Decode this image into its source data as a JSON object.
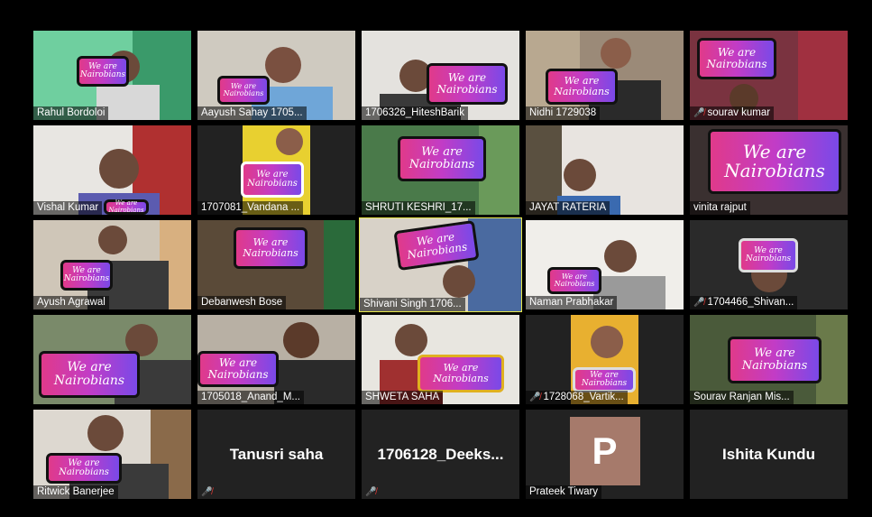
{
  "colors": {
    "background": "#000000",
    "active_speaker_border": "#e8e84a",
    "muted_icon": "#e53935",
    "avatar_bg": "#a67a6b"
  },
  "sign_text": "We are Nairobians",
  "participants": [
    {
      "name": "Rahul Bordoloi",
      "muted": false
    },
    {
      "name": "Aayush Sahay 1705...",
      "muted": false
    },
    {
      "name": "1706326_HiteshBarik",
      "muted": false
    },
    {
      "name": "Nidhi 1729038",
      "muted": false
    },
    {
      "name": "sourav kumar",
      "muted": true
    },
    {
      "name": "Vishal Kumar",
      "muted": false
    },
    {
      "name": "1707081_Vandana ...",
      "muted": false
    },
    {
      "name": "SHRUTI KESHRI_17...",
      "muted": false
    },
    {
      "name": "JAYAT RATERIA",
      "muted": false
    },
    {
      "name": "vinita rajput",
      "muted": false
    },
    {
      "name": "Ayush Agrawal",
      "muted": false
    },
    {
      "name": "Debanwesh Bose",
      "muted": false
    },
    {
      "name": "Shivani Singh 1706...",
      "muted": false,
      "active": true
    },
    {
      "name": "Naman Prabhakar",
      "muted": false
    },
    {
      "name": "1704466_Shivan...",
      "muted": true
    },
    {
      "name": "",
      "muted": false
    },
    {
      "name": "1705018_Anand_M...",
      "muted": false
    },
    {
      "name": "SHWETA SAHA",
      "muted": false
    },
    {
      "name": "1728068_Vartik...",
      "muted": true
    },
    {
      "name": "Sourav Ranjan Mis...",
      "muted": false
    },
    {
      "name": "Ritwick Banerjee",
      "muted": false
    },
    {
      "name": "Tanusri saha",
      "muted": true,
      "video_off": true
    },
    {
      "name": "1706128_Deeks...",
      "muted": true,
      "video_off": true
    },
    {
      "name": "Prateek Tiwary",
      "muted": false,
      "video_off": true,
      "avatar_letter": "P"
    },
    {
      "name": "Ishita Kundu",
      "muted": false,
      "video_off": true
    }
  ]
}
